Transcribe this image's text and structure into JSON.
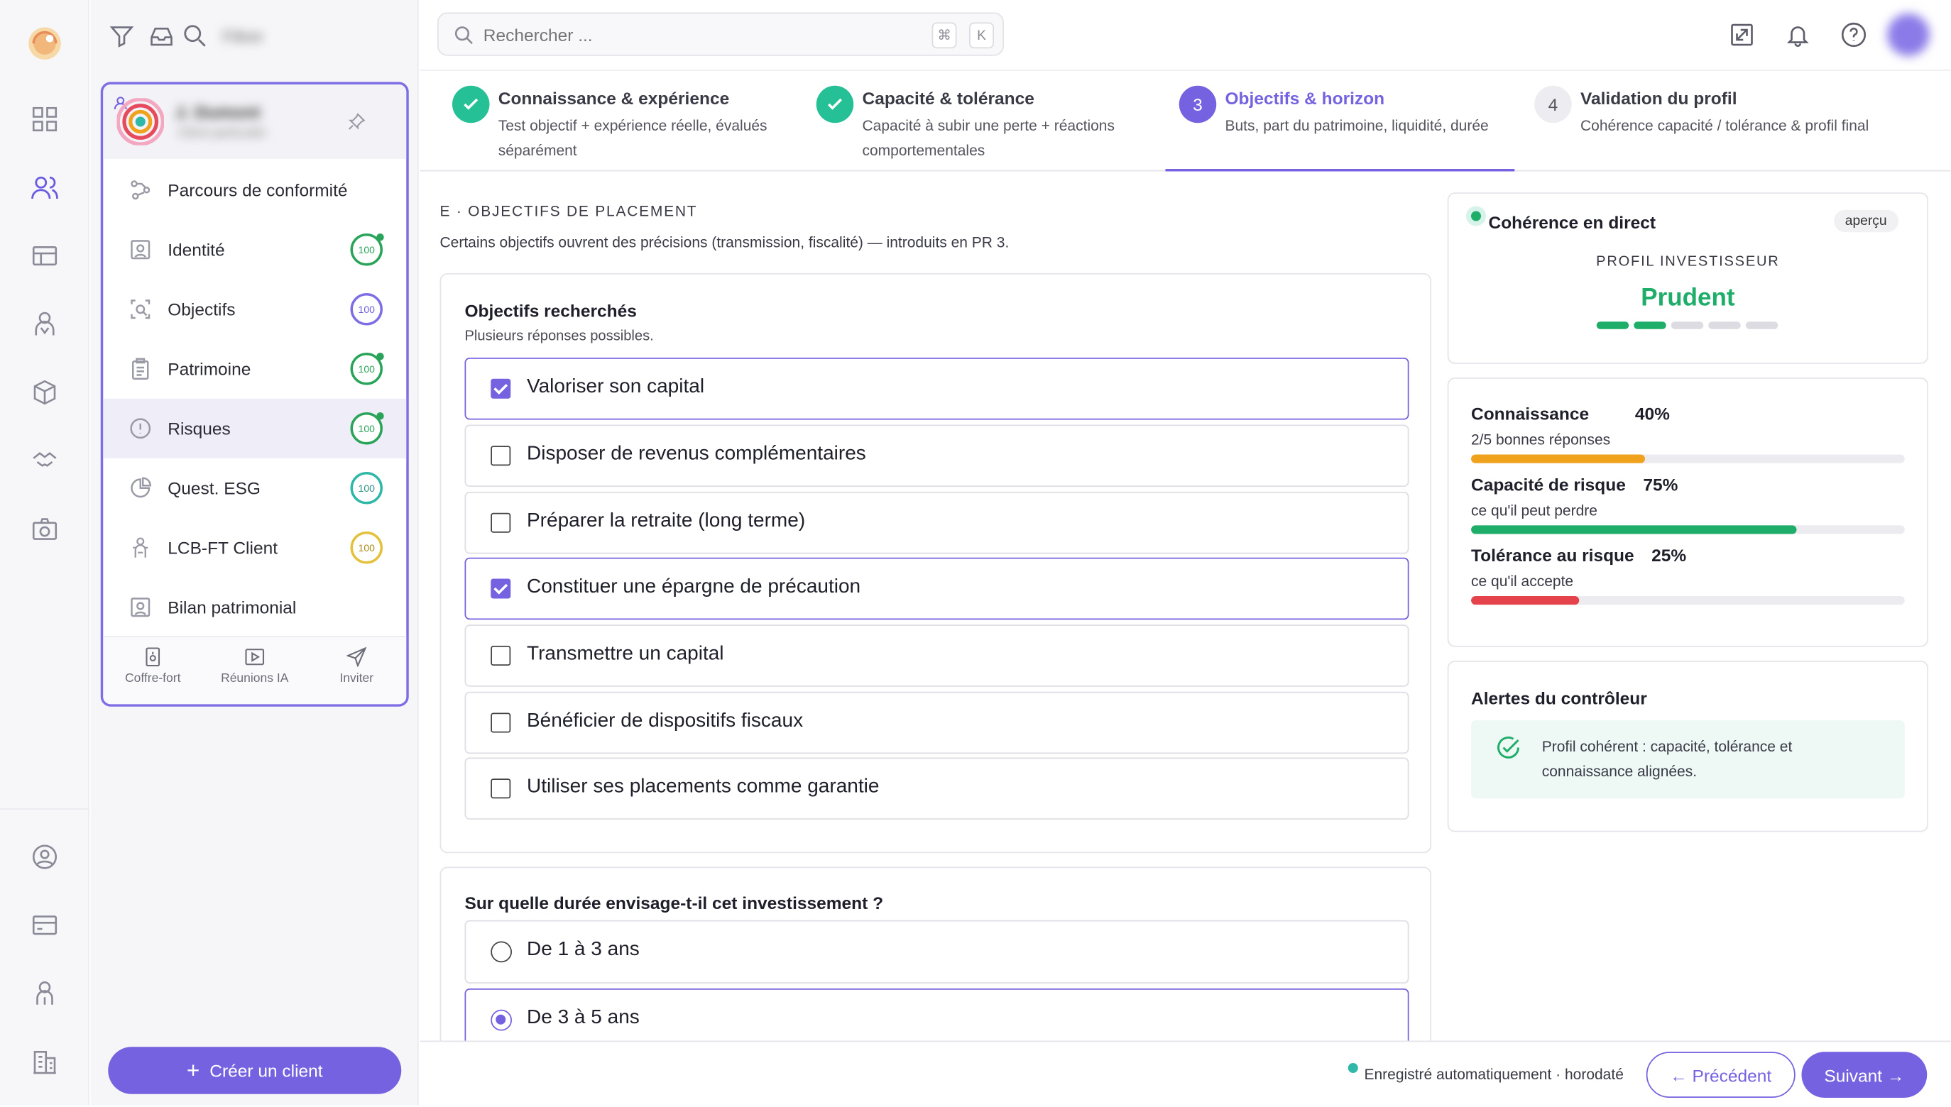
{
  "app": {
    "title": "Parcours de conformité"
  },
  "topbar": {
    "search_placeholder": "Rechercher ...",
    "shortcut_cmd": "⌘",
    "shortcut_key": "K"
  },
  "sidebar": {
    "blurred_filter_label": "Filtrer",
    "client_name": "J. Dumont",
    "client_sub": "Client particulier",
    "items": [
      {
        "label": "Parcours de conformité",
        "icon": "journey-icon"
      },
      {
        "label": "Identité",
        "icon": "id-card-icon",
        "score": "100",
        "color": "green"
      },
      {
        "label": "Objectifs",
        "icon": "target-icon",
        "score": "100",
        "color": "purple"
      },
      {
        "label": "Patrimoine",
        "icon": "clipboard-icon",
        "score": "100",
        "color": "green"
      },
      {
        "label": "Risques",
        "icon": "alert-icon",
        "score": "100",
        "color": "green"
      },
      {
        "label": "Quest. ESG",
        "icon": "pie-icon",
        "score": "100",
        "color": "teal"
      },
      {
        "label": "LCB-FT Client",
        "icon": "shield-user-icon",
        "score": "100",
        "color": "yellow"
      },
      {
        "label": "Bilan patrimonial",
        "icon": "portrait-icon"
      }
    ],
    "footer": [
      {
        "label": "Coffre-fort",
        "icon": "vault-icon"
      },
      {
        "label": "Réunions IA",
        "icon": "video-icon"
      },
      {
        "label": "Inviter",
        "icon": "send-icon"
      }
    ],
    "create_label": "Créer un client"
  },
  "stepper": {
    "steps": [
      {
        "num": "1",
        "title": "Connaissance & expérience",
        "desc": "Test objectif + expérience réelle, évalués séparément",
        "state": "done"
      },
      {
        "num": "2",
        "title": "Capacité & tolérance",
        "desc": "Capacité à subir une perte + réactions comportementales",
        "state": "done"
      },
      {
        "num": "3",
        "title": "Objectifs & horizon",
        "desc": "Buts, part du patrimoine, liquidité, durée",
        "state": "active"
      },
      {
        "num": "4",
        "title": "Validation du profil",
        "desc": "Cohérence capacité / tolérance & profil final",
        "state": "todo"
      }
    ]
  },
  "main": {
    "section_label": "E · OBJECTIFS DE PLACEMENT",
    "section_desc": "Certains objectifs ouvrent des précisions (transmission, fiscalité) — introduits en PR 3.",
    "objectives": {
      "title": "Objectifs recherchés",
      "subtitle": "Plusieurs réponses possibles.",
      "options": [
        {
          "label": "Valoriser son capital",
          "checked": true
        },
        {
          "label": "Disposer de revenus complémentaires",
          "checked": false
        },
        {
          "label": "Préparer la retraite (long terme)",
          "checked": false
        },
        {
          "label": "Constituer une épargne de précaution",
          "checked": true
        },
        {
          "label": "Transmettre un capital",
          "checked": false
        },
        {
          "label": "Bénéficier de dispositifs fiscaux",
          "checked": false
        },
        {
          "label": "Utiliser ses placements comme garantie",
          "checked": false
        }
      ]
    },
    "duration": {
      "title": "Sur quelle durée envisage-t-il cet investissement ?",
      "options": [
        {
          "label": "De 1 à 3 ans",
          "selected": false
        },
        {
          "label": "De 3 à 5 ans",
          "selected": true
        }
      ]
    }
  },
  "coherence": {
    "title": "Cohérence en direct",
    "badge": "aperçu",
    "profile_label": "PROFIL INVESTISSEUR",
    "profile_value": "Prudent",
    "profile_level": 2,
    "profile_levels": 5
  },
  "metrics": [
    {
      "title": "Connaissance",
      "value": "40%",
      "sub": "2/5 bonnes réponses",
      "fill": 0.4,
      "color": "#f0a21c"
    },
    {
      "title": "Capacité de risque",
      "value": "75%",
      "sub": "ce qu'il peut perdre",
      "fill": 0.75,
      "color": "#1fad6a"
    },
    {
      "title": "Tolérance au risque",
      "value": "25%",
      "sub": "ce qu'il accepte",
      "fill": 0.25,
      "color": "#e5434b"
    }
  ],
  "alerts": {
    "title": "Alertes du contrôleur",
    "message": "Profil cohérent : capacité, tolérance et connaissance alignées."
  },
  "footer": {
    "autosave": "Enregistré automatiquement · horodaté",
    "prev_label": "← Précédent",
    "next_label": "Suivant →"
  },
  "colors": {
    "accent": "#7462e0",
    "success": "#1fad6a",
    "warning": "#f0a21c",
    "danger": "#e5434b"
  }
}
